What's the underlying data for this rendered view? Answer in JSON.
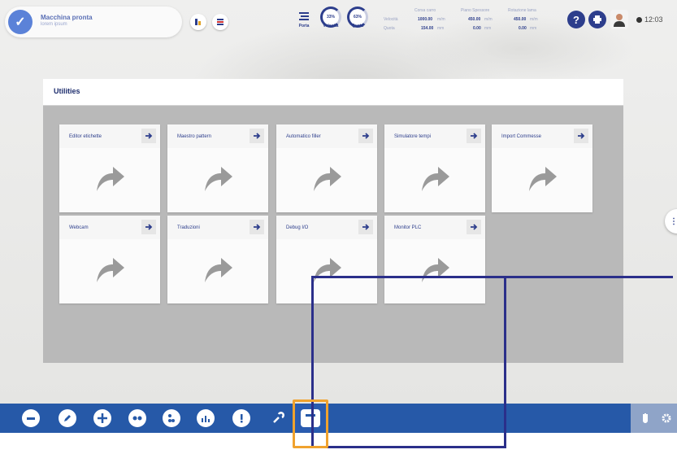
{
  "status": {
    "title": "Macchina pronta",
    "subtitle": "lorem ipsum"
  },
  "gauges": {
    "porta_label": "Porta",
    "velocita_label": "Velocità",
    "velocita_value": "33%",
    "quota_label": "Quota",
    "quota_value": "63%"
  },
  "stats": {
    "headers": [
      "Corsa carro",
      "Piano Spessore",
      "Rotazione lama"
    ],
    "rows": [
      {
        "label": "Velocità",
        "values": [
          "1000.00",
          "450.00",
          "450.00"
        ],
        "unit": "m/m"
      },
      {
        "label": "Quota",
        "values": [
          "154.00",
          "0.00",
          "0.00"
        ],
        "unit": "mm"
      }
    ]
  },
  "clock": "12:03",
  "panel": {
    "title": "Utilities",
    "cards": [
      {
        "label": "Editor etichette"
      },
      {
        "label": "Maestro pattern"
      },
      {
        "label": "Automatico filler"
      },
      {
        "label": "Simulatore tempi"
      },
      {
        "label": "Import Commesse"
      },
      {
        "label": "Webcam"
      },
      {
        "label": "Traduzioni"
      },
      {
        "label": "Debug I/O"
      },
      {
        "label": "Monitor PLC"
      }
    ]
  },
  "taskbar": {
    "items": [
      "minus-icon",
      "edit-icon",
      "move-icon",
      "link-icon",
      "settings-icon",
      "chart-icon",
      "alert-icon",
      "wrench-icon",
      "window-icon"
    ],
    "active": "window-icon"
  },
  "colors": {
    "navy": "#2d3e8c",
    "taskbar": "#2659a8",
    "highlight": "#f0a22e",
    "annotation": "#2b2f8a",
    "panel_bg": "#b9b9b9"
  }
}
